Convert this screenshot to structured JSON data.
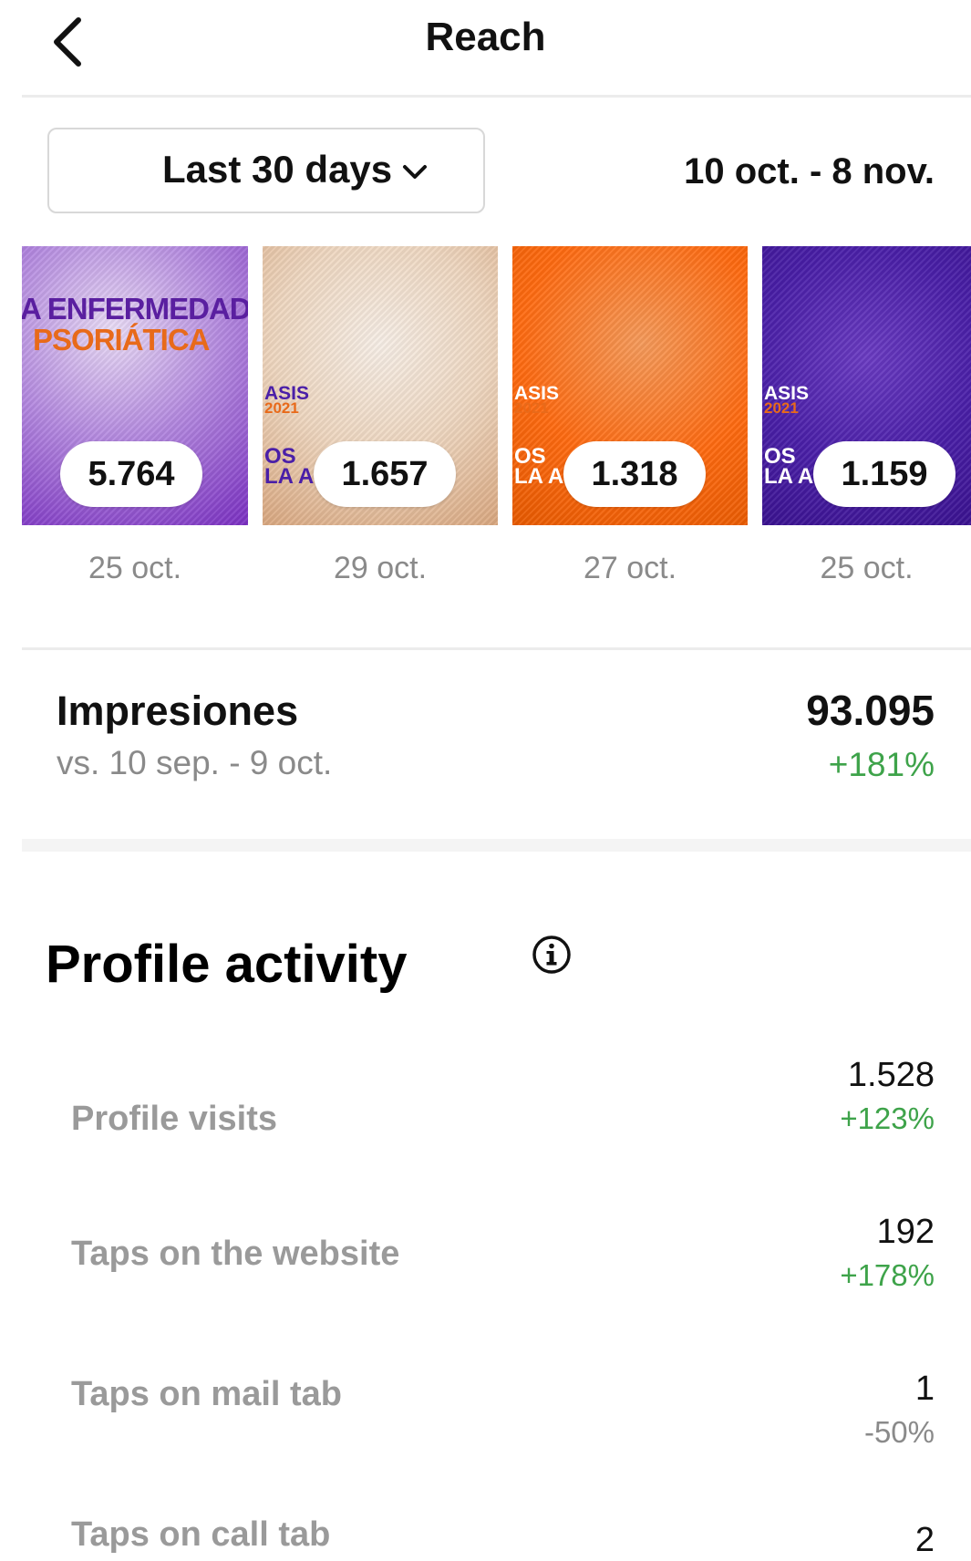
{
  "header": {
    "title": "Reach"
  },
  "filter": {
    "range_label": "Last 30 days",
    "date_range": "10 oct. - 8 nov."
  },
  "posts": [
    {
      "value": "5.764",
      "date": "25 oct.",
      "text_line1": "A ENFERMEDAD",
      "text_line2": "PSORIÁTICA"
    },
    {
      "value": "1.657",
      "date": "29 oct.",
      "logo_line1": "ASIS",
      "logo_line2": "2021",
      "side_line1": "OS",
      "side_line2": "LA A"
    },
    {
      "value": "1.318",
      "date": "27 oct.",
      "logo_line1": "ASIS",
      "logo_line2": "2021",
      "side_line1": "OS",
      "side_line2": "LA A"
    },
    {
      "value": "1.159",
      "date": "25 oct.",
      "logo_line1": "ASIS",
      "logo_line2": "2021",
      "side_line1": "OS",
      "side_line2": "LA A"
    }
  ],
  "impressions": {
    "label": "Impresiones",
    "compare": "vs. 10 sep. - 9 oct.",
    "value": "93.095",
    "change": "+181%"
  },
  "profile_activity": {
    "title": "Profile activity",
    "metrics": [
      {
        "label": "Profile visits",
        "value": "1.528",
        "change": "+123%"
      },
      {
        "label": "Taps on the website",
        "value": "192",
        "change": "+178%"
      },
      {
        "label": "Taps on mail tab",
        "value": "1",
        "change": "-50%"
      },
      {
        "label": "Taps on call tab",
        "value": "2"
      }
    ]
  },
  "colors": {
    "positive": "#3ea34a",
    "muted": "#8a8a8a"
  },
  "icons": [
    "back-icon",
    "chevron-down-icon",
    "info-icon"
  ]
}
